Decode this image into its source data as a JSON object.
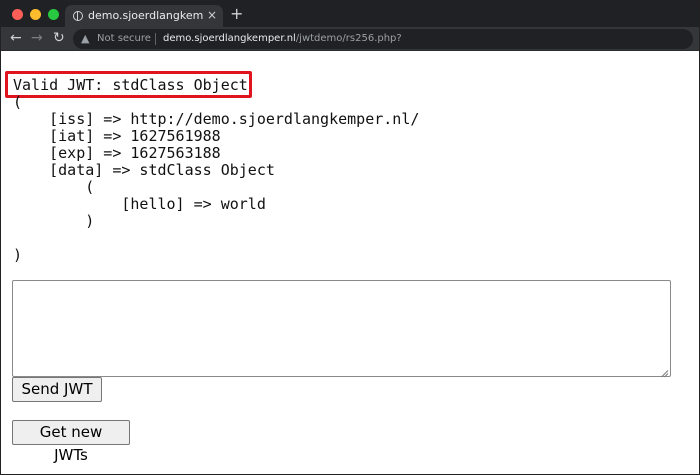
{
  "browser": {
    "tab_title": "demo.sjoerdlangkemper.nl",
    "tab_close": "×",
    "new_tab": "+",
    "nav_back": "←",
    "nav_forward": "→",
    "nav_reload": "↻",
    "security_label": "Not secure",
    "url_host": "demo.sjoerdlangkemper.nl",
    "url_path": "/jwtdemo/rs256.php?"
  },
  "output": {
    "lines": [
      "Valid JWT: stdClass Object",
      "(",
      "    [iss] => http://demo.sjoerdlangkemper.nl/",
      "    [iat] => 1627561988",
      "    [exp] => 1627563188",
      "    [data] => stdClass Object",
      "        (",
      "            [hello] => world",
      "        )",
      "",
      ")"
    ]
  },
  "form": {
    "jwt_textarea_value": "",
    "send_button": "Send JWT",
    "get_button": "Get new JWTs"
  },
  "colors": {
    "highlight": "#e0141e",
    "chrome_dark": "#202124",
    "chrome_toolbar": "#35363a"
  }
}
